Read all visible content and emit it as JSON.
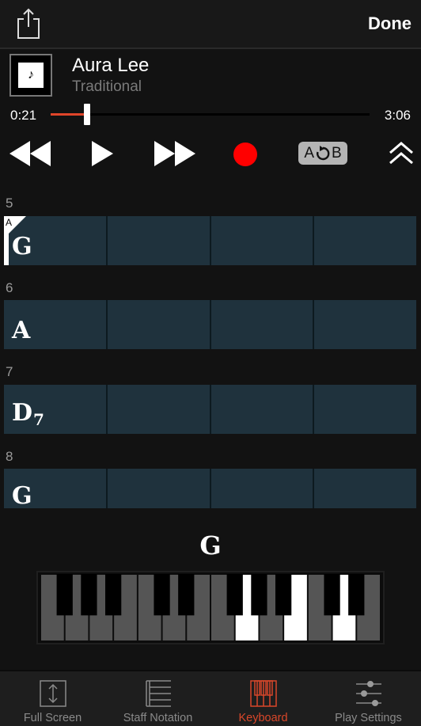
{
  "header": {
    "share_icon": "share-icon",
    "done_label": "Done"
  },
  "song": {
    "title": "Aura Lee",
    "artist": "Traditional",
    "art_icon": "music-note-icon",
    "art_glyph": "♪"
  },
  "player": {
    "current_time": "0:21",
    "total_time": "3:06",
    "progress_fraction": 0.113,
    "accent_color": "#e0452a",
    "record_color": "#ff0000",
    "ab_repeat": {
      "a_label": "A",
      "b_label": "B"
    },
    "controls": [
      "rewind-icon",
      "play-icon",
      "fast-forward-icon",
      "record-icon",
      "ab-repeat-icon",
      "collapse-icon"
    ]
  },
  "measures": [
    {
      "number": "5",
      "chord": "G",
      "suffix": "",
      "marker": "A",
      "beats": 4
    },
    {
      "number": "6",
      "chord": "A",
      "suffix": "",
      "beats": 4
    },
    {
      "number": "7",
      "chord": "D",
      "suffix": "7",
      "beats": 4
    },
    {
      "number": "8",
      "chord": "G",
      "suffix": "",
      "beats": 4
    }
  ],
  "keyboard": {
    "current_chord": "G",
    "white_keys": [
      "F",
      "G",
      "A",
      "B",
      "C",
      "D",
      "E",
      "F",
      "G",
      "A",
      "B",
      "C",
      "D",
      "E"
    ],
    "highlighted_white_key_indices": [
      8,
      10,
      12
    ],
    "highlighted_notes": [
      "G",
      "B",
      "D"
    ]
  },
  "tabs": [
    {
      "label": "Full Screen",
      "icon": "full-screen-icon",
      "active": false
    },
    {
      "label": "Staff Notation",
      "icon": "staff-notation-icon",
      "active": false
    },
    {
      "label": "Keyboard",
      "icon": "keyboard-icon",
      "active": true
    },
    {
      "label": "Play Settings",
      "icon": "play-settings-icon",
      "active": false
    }
  ]
}
